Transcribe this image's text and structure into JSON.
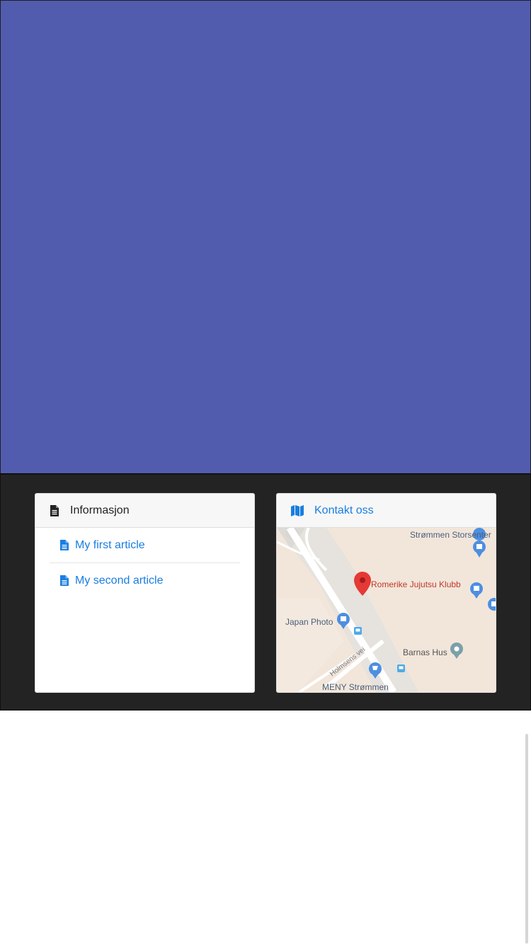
{
  "colors": {
    "hero_bg": "#525cae",
    "footer_bg": "#232323",
    "link": "#1a7ee0"
  },
  "info_card": {
    "icon": "document-icon",
    "title": "Informasjon",
    "articles": [
      {
        "icon": "document-icon",
        "label": "My first article"
      },
      {
        "icon": "document-icon",
        "label": "My second article"
      }
    ]
  },
  "contact_card": {
    "icon": "map-icon",
    "title": "Kontakt oss",
    "map": {
      "labels": {
        "storsenter": "Strømmen Storsenter",
        "club": "Romerike Jujutsu Klubb",
        "japan_photo": "Japan Photo",
        "barnas_hus": "Barnas Hus",
        "holmsens_vei": "Holmsens vei",
        "meny": "MENY Strømmen"
      }
    }
  }
}
